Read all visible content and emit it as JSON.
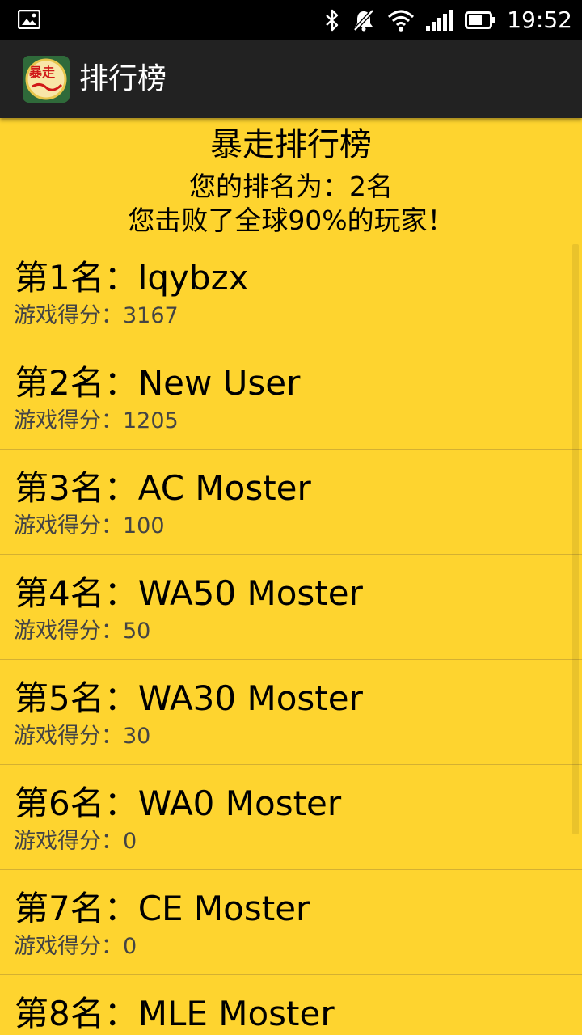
{
  "status_bar": {
    "time": "19:52",
    "icons": [
      "image-notification-icon",
      "bluetooth-icon",
      "muted-bell-icon",
      "wifi-icon",
      "signal-icon",
      "battery-icon"
    ]
  },
  "action_bar": {
    "title": "排行榜",
    "app_icon": {
      "name": "app-logo-icon",
      "text": "暴走"
    }
  },
  "header": {
    "title": "暴走排行榜",
    "rank_text": "您的排名为：2名",
    "beat_text": "您击败了全球90%的玩家！"
  },
  "leaderboard": [
    {
      "name": "第1名：lqybzx",
      "score": "游戏得分：3167"
    },
    {
      "name": "第2名：New User",
      "score": "游戏得分：1205"
    },
    {
      "name": "第3名：AC Moster",
      "score": "游戏得分：100"
    },
    {
      "name": "第4名：WA50 Moster",
      "score": "游戏得分：50"
    },
    {
      "name": "第5名：WA30 Moster",
      "score": "游戏得分：30"
    },
    {
      "name": "第6名：WA0 Moster",
      "score": "游戏得分：0"
    },
    {
      "name": "第7名：CE Moster",
      "score": "游戏得分：0"
    },
    {
      "name": "第8名：MLE Moster",
      "score": ""
    }
  ],
  "colors": {
    "background": "#FED42F",
    "action_bar": "#222222",
    "status_bar": "#000000",
    "divider": "#D4B032"
  }
}
